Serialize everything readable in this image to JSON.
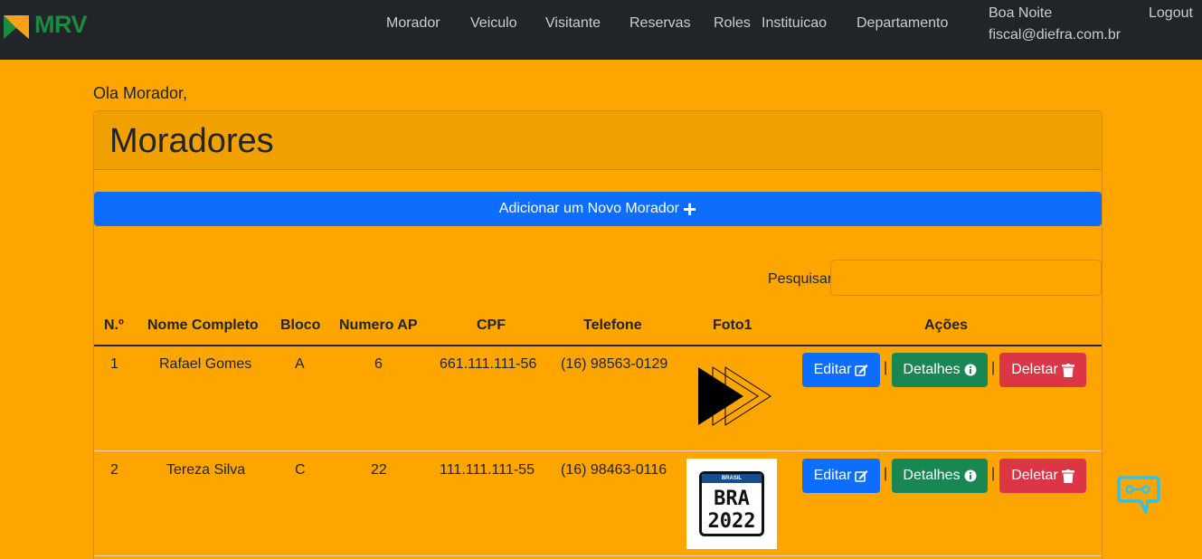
{
  "brand": {
    "logo_text": "MRV"
  },
  "nav": {
    "items": [
      "Morador",
      "Veiculo",
      "Visitante",
      "Reservas",
      "Roles",
      "Instituicao",
      "Departamento"
    ],
    "greeting": "Boa Noite",
    "email": "fiscal@diefra.com.br",
    "logout": "Logout"
  },
  "page": {
    "hello": "Ola Morador,",
    "title": "Moradores",
    "add_button": "Adicionar um Novo Morador",
    "search_label": "Pesquisar",
    "search_value": ""
  },
  "table": {
    "headers": [
      "N.º",
      "Nome Completo",
      "Bloco",
      "Numero AP",
      "CPF",
      "Telefone",
      "Foto1",
      "Ações"
    ],
    "rows": [
      {
        "n": "1",
        "nome": "Rafael Gomes",
        "bloco": "A",
        "ap": "6",
        "cpf": "661.111.111-56",
        "telefone": "(16) 98563-0129",
        "foto": "play-arrows-icon"
      },
      {
        "n": "2",
        "nome": "Tereza Silva",
        "bloco": "C",
        "ap": "22",
        "cpf": "111.111.111-55",
        "telefone": "(16) 98463-0116",
        "foto": "license-plate-image"
      }
    ],
    "actions": {
      "edit": "Editar",
      "details": "Detalhes",
      "delete": "Deletar",
      "separator": "|"
    }
  },
  "plate": {
    "country": "BRASIL",
    "line1": "BRA",
    "line2": "2022"
  },
  "colors": {
    "page_bg": "#FFA500",
    "navbar": "#212529",
    "primary": "#0d6efd",
    "success": "#198754",
    "danger": "#dc3545"
  }
}
